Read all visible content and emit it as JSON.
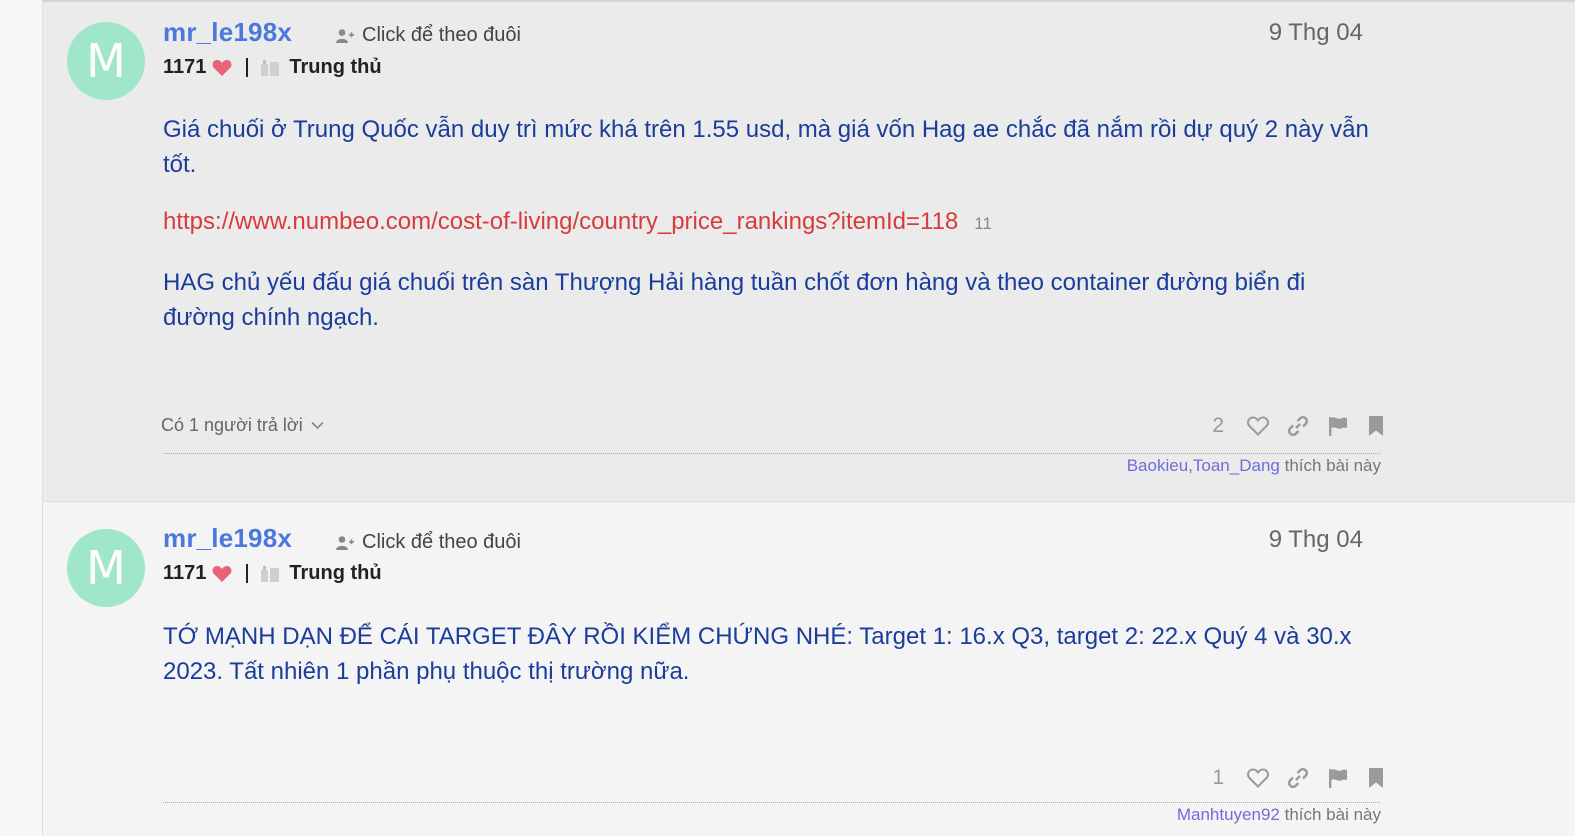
{
  "posts": [
    {
      "avatar_letter": "M",
      "username": "mr_le198x",
      "follow_label": "Click để theo đuôi",
      "score": "1171",
      "rank": "Trung thủ",
      "date": "9 Thg 04",
      "paragraph1": "Giá chuối ở Trung Quốc vẫn duy trì mức khá trên 1.55 usd, mà giá vốn Hag ae chắc đã nắm rồi dự quý 2 này vẫn tốt.",
      "link": "https://www.numbeo.com/cost-of-living/country_price_rankings?itemId=118",
      "link_clicks": "11",
      "paragraph2": "HAG chủ yếu đấu giá chuối trên sàn Thượng Hải hàng tuần chốt đơn hàng và theo container đường biển đi đường chính ngạch.",
      "replies_label": "Có 1 người trả lời",
      "like_count": "2",
      "likers": [
        "Baokieu",
        "Toan_Dang"
      ],
      "likers_sep": ",",
      "likes_suffix": "thích bài này"
    },
    {
      "avatar_letter": "M",
      "username": "mr_le198x",
      "follow_label": "Click để theo đuôi",
      "score": "1171",
      "rank": "Trung thủ",
      "date": "9 Thg 04",
      "paragraph1": "TỚ MẠNH DẠN ĐỂ CÁI TARGET ĐÂY RỒI KIỂM CHỨNG NHÉ: Target 1: 16.x Q3, target 2: 22.x Quý 4 và 30.x 2023. Tất nhiên 1 phần phụ thuộc thị trường nữa.",
      "like_count": "1",
      "likers": [
        "Manhtuyen92"
      ],
      "likes_suffix": "thích bài này"
    }
  ],
  "colors": {
    "avatar_bg": "#9fe7c8",
    "username": "#4a78de",
    "body_text": "#1a3d9c",
    "link": "#d93b3b",
    "liker_name": "#6f6cde",
    "heart": "#e8627a"
  },
  "icons": {
    "follow": "user-plus-icon",
    "score": "heart-icon",
    "rank": "badge-icon",
    "replies": "chevron-down-icon",
    "like": "heart-outline-icon",
    "share": "link-icon",
    "flag": "flag-icon",
    "bookmark": "bookmark-icon"
  }
}
